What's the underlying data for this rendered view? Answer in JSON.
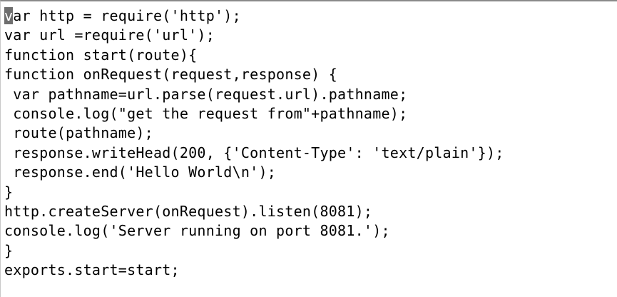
{
  "editor": {
    "cursor_char": "v",
    "first_line_rest": "ar http = require('http');",
    "lines": [
      "var http = require('http');",
      "var url =require('url');",
      "function start(route){",
      "function onRequest(request,response) {",
      " var pathname=url.parse(request.url).pathname;",
      " console.log(\"get the request from\"+pathname);",
      " route(pathname);",
      " response.writeHead(200, {'Content-Type': 'text/plain'});",
      " response.end('Hello World\\n');",
      "}",
      "http.createServer(onRequest).listen(8081);",
      "console.log('Server running on port 8081.');",
      "}",
      "exports.start=start;"
    ]
  }
}
